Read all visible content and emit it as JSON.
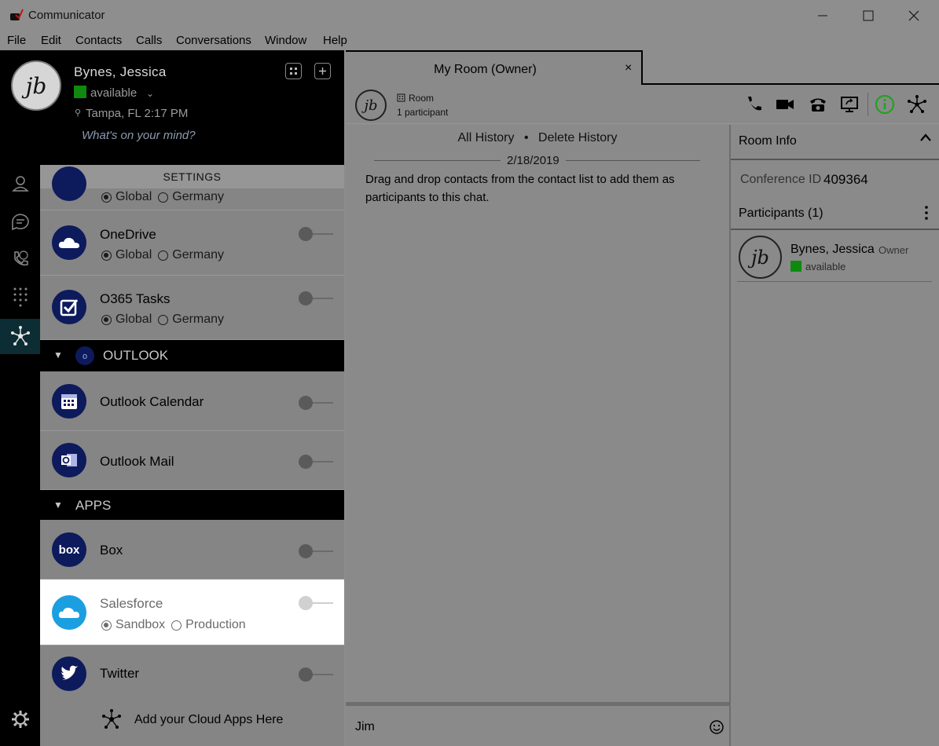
{
  "window": {
    "title": "Communicator"
  },
  "menu": [
    "File",
    "Edit",
    "Contacts",
    "Calls",
    "Conversations",
    "Window",
    "Help"
  ],
  "profile": {
    "initials": "jb",
    "name": "Bynes, Jessica",
    "status": "available",
    "location": "Tampa, FL  2:17 PM",
    "mind_placeholder": "What's on your mind?"
  },
  "settings": {
    "header": "SETTINGS",
    "partial_item": {
      "option_1": "Global",
      "option_2": "Germany"
    },
    "onedrive": {
      "title": "OneDrive",
      "option_1": "Global",
      "option_2": "Germany"
    },
    "o365": {
      "title": "O365 Tasks",
      "option_1": "Global",
      "option_2": "Germany"
    },
    "outlook_section": "OUTLOOK",
    "outlook_calendar": {
      "title": "Outlook Calendar"
    },
    "outlook_mail": {
      "title": "Outlook Mail"
    },
    "apps_section": "APPS",
    "box": {
      "title": "Box"
    },
    "salesforce": {
      "title": "Salesforce",
      "option_1": "Sandbox",
      "option_2": "Production"
    },
    "twitter": {
      "title": "Twitter"
    },
    "add_cloud": "Add your Cloud Apps Here"
  },
  "tab": {
    "title": "My Room (Owner)",
    "close": "×"
  },
  "room": {
    "initials": "jb",
    "label": "Room",
    "participants": "1 participant"
  },
  "chat": {
    "all_history": "All History",
    "separator": "•",
    "delete_history": "Delete History",
    "date": "2/18/2019",
    "message": "Drag and drop contacts from the contact list to add them as participants to this chat.",
    "input_value": "Jim"
  },
  "room_info": {
    "title": "Room Info",
    "conference_label": "Conference ID",
    "conference_id": "409364",
    "participants_title": "Participants (1)",
    "participant": {
      "initials": "jb",
      "name": "Bynes, Jessica",
      "role": "Owner",
      "status": "available"
    }
  },
  "colors": {
    "available": "#0f8a0f",
    "info_accent": "#1fa31f"
  }
}
